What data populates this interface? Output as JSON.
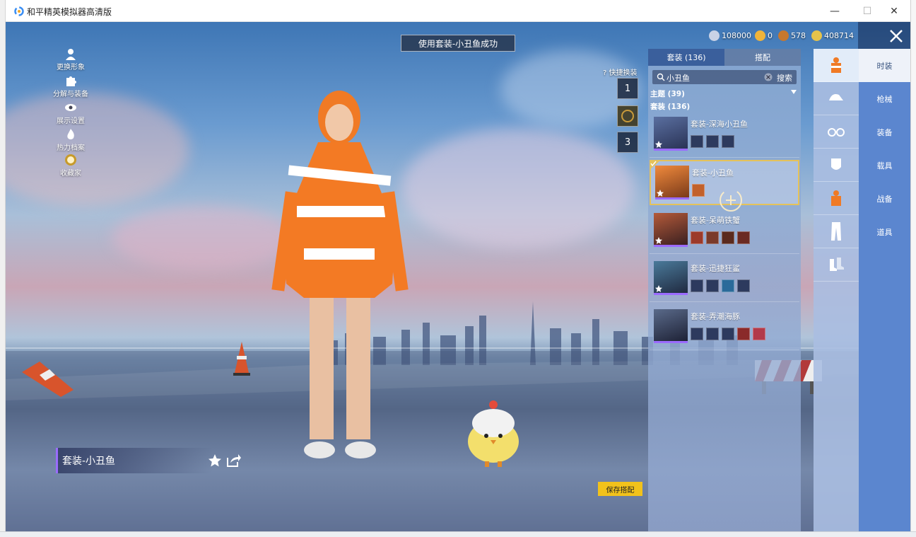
{
  "window": {
    "title": "和平精英模拟器高清版",
    "controls": {
      "minimize": "—",
      "maximize": "☐",
      "close": "✕"
    }
  },
  "left_menu": [
    {
      "label": "更换形象",
      "icon": "person-icon"
    },
    {
      "label": "分解与装备",
      "icon": "puzzle-icon"
    },
    {
      "label": "展示设置",
      "icon": "eye-icon"
    },
    {
      "label": "热力档案",
      "icon": "flame-icon"
    },
    {
      "label": "收藏家",
      "icon": "collector-badge-icon"
    }
  ],
  "toast": "使用套装-小丑鱼成功",
  "currencies": [
    {
      "value": "108000",
      "icon": "silver-coin-icon",
      "color": "#c9d2e6"
    },
    {
      "value": "0",
      "icon": "gold-coin-icon",
      "color": "#f0b43a"
    },
    {
      "value": "578",
      "icon": "bronze-coin-icon",
      "color": "#c8782e"
    },
    {
      "value": "408714",
      "icon": "token-coin-icon",
      "color": "#e6c34a"
    }
  ],
  "quick_change": {
    "label": "快捷换装",
    "slots": [
      "1",
      "",
      "3"
    ]
  },
  "panel": {
    "tabs": [
      {
        "label": "套装 (136)"
      },
      {
        "label": "搭配"
      }
    ],
    "search": {
      "value": "小丑鱼",
      "button": "搜索"
    },
    "groups": {
      "theme": "主题 (39)",
      "suit": "套装 (136)"
    },
    "suits": [
      {
        "name": "套装-深海小丑鱼",
        "pieces": 3,
        "selected": false
      },
      {
        "name": "套装-小丑鱼",
        "pieces": 1,
        "selected": true
      },
      {
        "name": "套装-呆萌铁蟹",
        "pieces": 4,
        "selected": false
      },
      {
        "name": "套装-迅捷狂鲨",
        "pieces": 4,
        "selected": false
      },
      {
        "name": "套装-弄潮海豚",
        "pieces": 5,
        "selected": false
      }
    ]
  },
  "categories": [
    {
      "icon": "outfit-icon",
      "active": true
    },
    {
      "icon": "cap-icon",
      "active": false
    },
    {
      "icon": "glasses-icon",
      "active": false
    },
    {
      "icon": "mask-icon",
      "active": false
    },
    {
      "icon": "top-icon",
      "active": false
    },
    {
      "icon": "pants-icon",
      "active": false
    },
    {
      "icon": "shoes-icon",
      "active": false
    }
  ],
  "nav": [
    {
      "label": "时装",
      "active": true
    },
    {
      "label": "枪械",
      "active": false
    },
    {
      "label": "装备",
      "active": false
    },
    {
      "label": "载具",
      "active": false
    },
    {
      "label": "战备",
      "active": false
    },
    {
      "label": "道具",
      "active": false
    }
  ],
  "outfit_label": "套装-小丑鱼",
  "save_button": "保存搭配"
}
